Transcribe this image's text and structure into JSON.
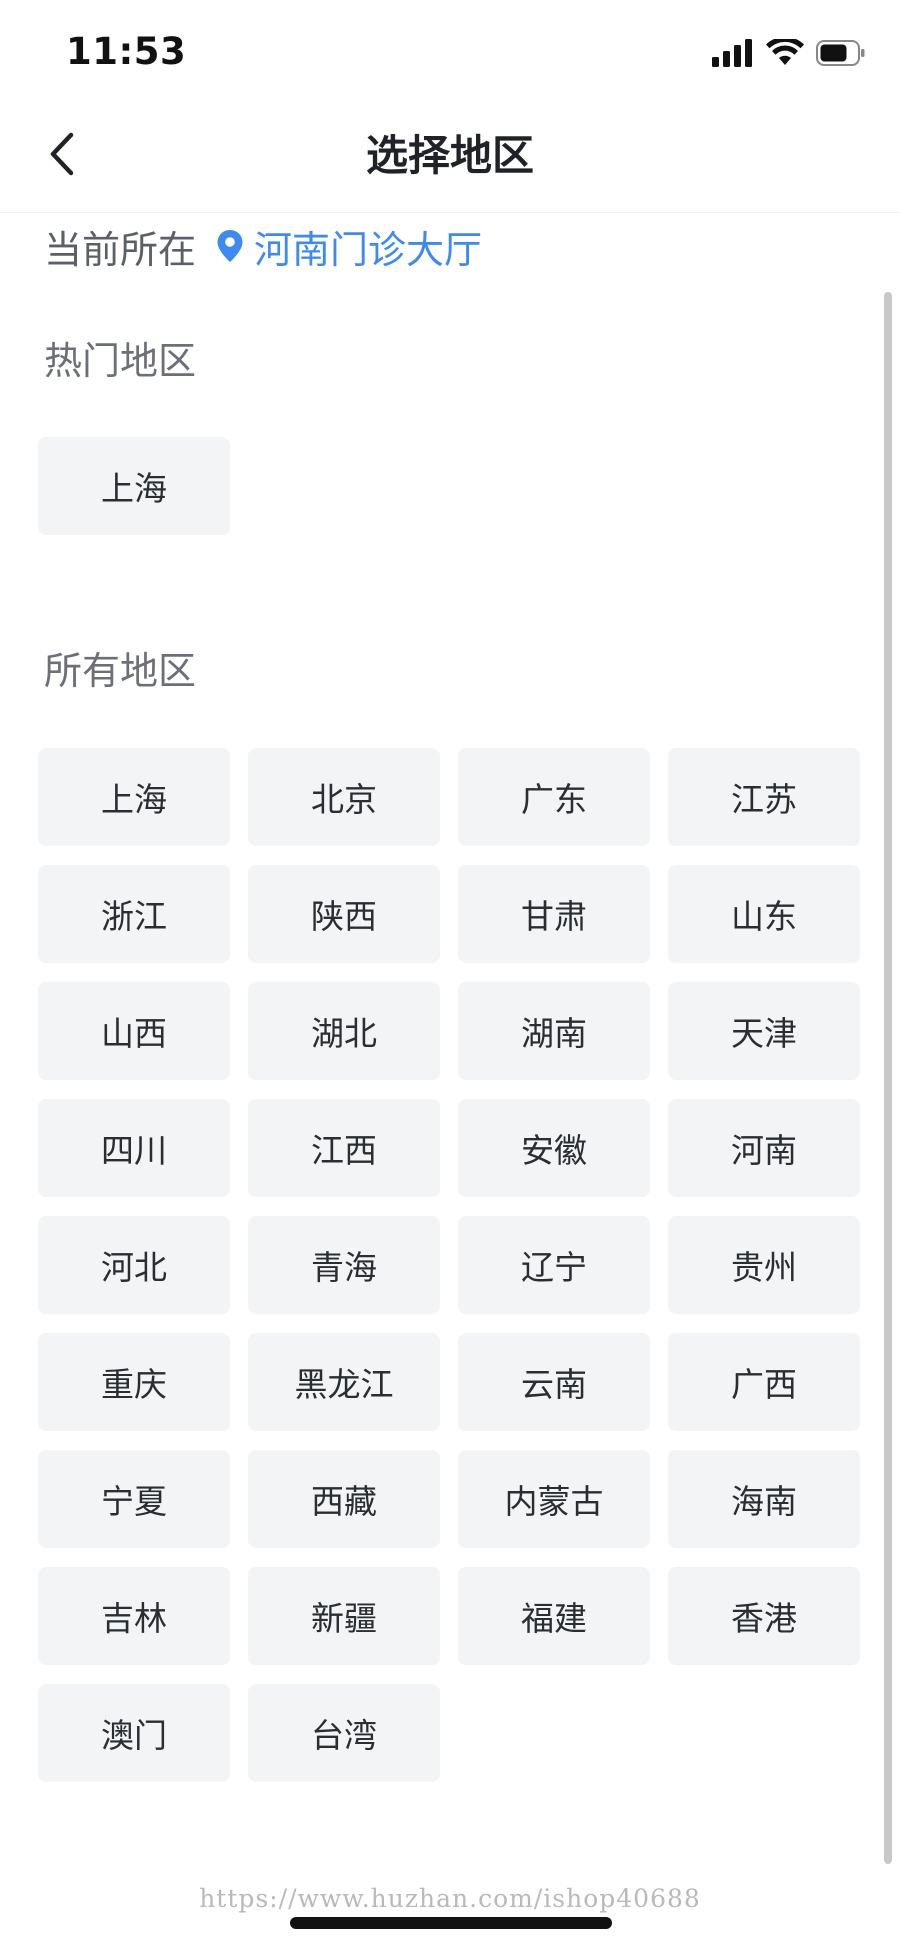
{
  "status_bar": {
    "time": "11:53",
    "icons": [
      "signal-icon",
      "wifi-icon",
      "battery-icon"
    ]
  },
  "nav": {
    "title": "选择地区",
    "back_icon": "chevron-left-icon"
  },
  "current": {
    "label": "当前所在",
    "location": "河南门诊大厅",
    "icon": "location-pin-icon",
    "accent_color": "#3d8bf2"
  },
  "hot": {
    "title": "热门地区",
    "regions": [
      "上海"
    ]
  },
  "all": {
    "title": "所有地区",
    "regions": [
      "上海",
      "北京",
      "广东",
      "江苏",
      "浙江",
      "陕西",
      "甘肃",
      "山东",
      "山西",
      "湖北",
      "湖南",
      "天津",
      "四川",
      "江西",
      "安徽",
      "河南",
      "河北",
      "青海",
      "辽宁",
      "贵州",
      "重庆",
      "黑龙江",
      "云南",
      "广西",
      "宁夏",
      "西藏",
      "内蒙古",
      "海南",
      "吉林",
      "新疆",
      "福建",
      "香港",
      "澳门",
      "台湾"
    ]
  },
  "watermark": "https://www.huzhan.com/ishop40688"
}
